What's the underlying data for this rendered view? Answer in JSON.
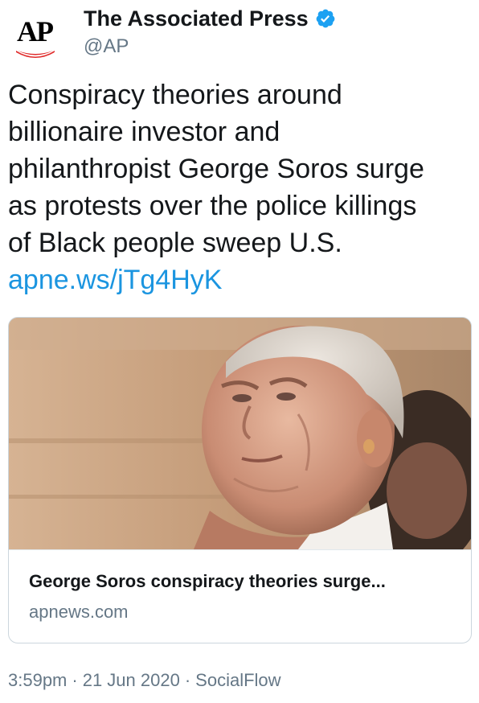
{
  "header": {
    "avatar_text": "AP",
    "display_name": "The Associated Press",
    "handle": "@AP",
    "verified": true
  },
  "tweet": {
    "text_lines": [
      "Conspiracy theories around",
      "billionaire investor and",
      "philanthropist George Soros surge",
      "as protests over the police killings",
      "of Black people sweep U.S."
    ],
    "link": "apne.ws/jTg4HyK"
  },
  "card": {
    "title": "George Soros conspiracy theories surge...",
    "domain": "apnews.com"
  },
  "footer": {
    "time": "3:59pm",
    "date": "21 Jun 2020",
    "source": "SocialFlow",
    "separator": "·"
  },
  "colors": {
    "link": "#1b95e0",
    "secondary_text": "#657786",
    "verified_badge": "#1da1f2",
    "ap_red": "#e02a2a",
    "border": "#ccd6dd"
  },
  "icons": {
    "verified": "verified-badge-icon",
    "avatar": "ap-logo-icon"
  }
}
